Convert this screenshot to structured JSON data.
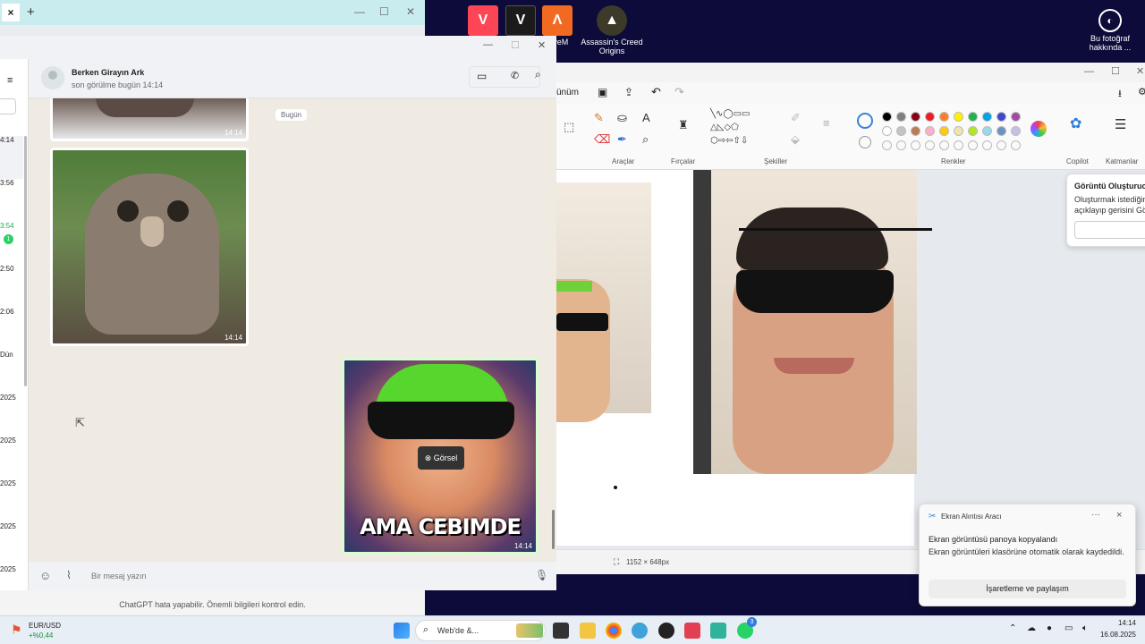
{
  "desktop": {
    "icons": [
      {
        "label": "",
        "icon": "valorant-icon"
      },
      {
        "label": "",
        "icon": "gta-v-icon"
      },
      {
        "label": "FiveM",
        "icon": "fivem-icon"
      },
      {
        "label": "Assassin's Creed Origins",
        "icon": "ac-origins-icon"
      },
      {
        "label": "Bu fotoğraf hakkında ...",
        "icon": "camera-info-icon"
      }
    ]
  },
  "whatsapp": {
    "contact_name": "Berken Girayın Ark",
    "contact_status": "son görülme bugün 14:14",
    "date_divider": "Bugün",
    "image_times": [
      "14:14",
      "14:14",
      "14:14"
    ],
    "meme_caption": "AMA CEBIMDE",
    "overlay_label": "Görsel",
    "message_placeholder": "Bir mesaj yazın",
    "sidebar_times": [
      "4:14",
      "3:56",
      "3:54",
      "2:50",
      "2:06",
      "Dün",
      "2025",
      "2025",
      "2025",
      "2025",
      "2025"
    ],
    "sidebar_badge": "1"
  },
  "chatgpt_notice": "ChatGPT hata yapabilir. Önemli bilgileri kontrol edin.",
  "paint": {
    "menu_fragment": "ünüm",
    "groups": [
      "Araçlar",
      "Fırçalar",
      "Şekiller",
      "Renkler",
      "Copilot",
      "Katmanlar"
    ],
    "popup_title": "Görüntü Oluşturucu",
    "popup_text": "Oluşturmak istediğiniz açıklayıp gerisini Gö",
    "canvas_size": "1152 × 648px",
    "colors_row1": [
      "#000000",
      "#7f7f7f",
      "#880015",
      "#ed1c24",
      "#ff7f27",
      "#fff200",
      "#22b14c",
      "#00a2e8",
      "#3f48cc",
      "#a349a4"
    ],
    "colors_row2": [
      "#ffffff",
      "#c3c3c3",
      "#b97a57",
      "#ffaec9",
      "#ffc90e",
      "#efe4b0",
      "#b5e61d",
      "#99d9ea",
      "#7092be",
      "#c8bfe7"
    ]
  },
  "toast": {
    "app_name": "Ekran Alıntısı Aracı",
    "title": "Ekran görüntüsü panoya kopyalandı",
    "body": "Ekran görüntüleri klasörüne otomatik olarak kaydedildi.",
    "action": "İşaretleme ve paylaşım",
    "more": "···",
    "close": "×"
  },
  "taskbar": {
    "weather_label": "EUR/USD",
    "weather_value": "+%0,44",
    "search_placeholder": "Web'de &...",
    "time": "14:14",
    "date": "16.08.2025",
    "whatsapp_badge": "3"
  }
}
